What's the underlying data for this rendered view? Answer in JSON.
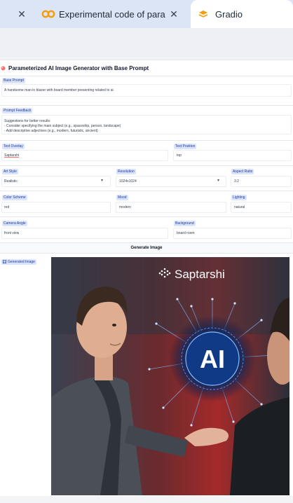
{
  "browser": {
    "tabs": [
      {
        "title": "Experimental code of param",
        "icon": "colab-icon",
        "active": false
      },
      {
        "title": "Gradio",
        "icon": "gradio-icon",
        "active": true
      }
    ]
  },
  "app": {
    "title": "Parameterized AI Image Generator with Base Prompt"
  },
  "fields": {
    "base_prompt": {
      "label": "Base Prompt",
      "value": "A handsome man in blazer with board member presenting related to ai"
    },
    "prompt_feedback": {
      "label": "Prompt Feedback",
      "line1": "Suggestions for better results:",
      "line2": "- Consider specifying the main subject (e.g., spaceship, person, landscape)",
      "line3": "- Add descriptive adjectives (e.g., modern, futuristic, ancient)"
    },
    "text_overlay": {
      "label": "Text Overlay",
      "value": "Saptarshi"
    },
    "text_position": {
      "label": "Text Position",
      "value": "top"
    },
    "art_style": {
      "label": "Art Style",
      "value": "Realistic"
    },
    "resolution": {
      "label": "Resolution",
      "value": "1024x1024"
    },
    "aspect_ratio": {
      "label": "Aspect Ratio",
      "value": "3:2"
    },
    "color_scheme": {
      "label": "Color Scheme",
      "value": "red"
    },
    "mood": {
      "label": "Mood",
      "value": "modern"
    },
    "lighting": {
      "label": "Lighting",
      "value": "natural"
    },
    "camera_angle": {
      "label": "Camera Angle",
      "value": "front view"
    },
    "background": {
      "label": "Background",
      "value": "board room"
    }
  },
  "generate_button": "Generate Image",
  "output": {
    "label": "Generated Image",
    "overlay_text": "Saptarshi",
    "center_text": "AI"
  },
  "colors": {
    "label_bg": "#dbe4ff",
    "accent": "#f97316",
    "tab_bg": "#dbe5f5"
  }
}
